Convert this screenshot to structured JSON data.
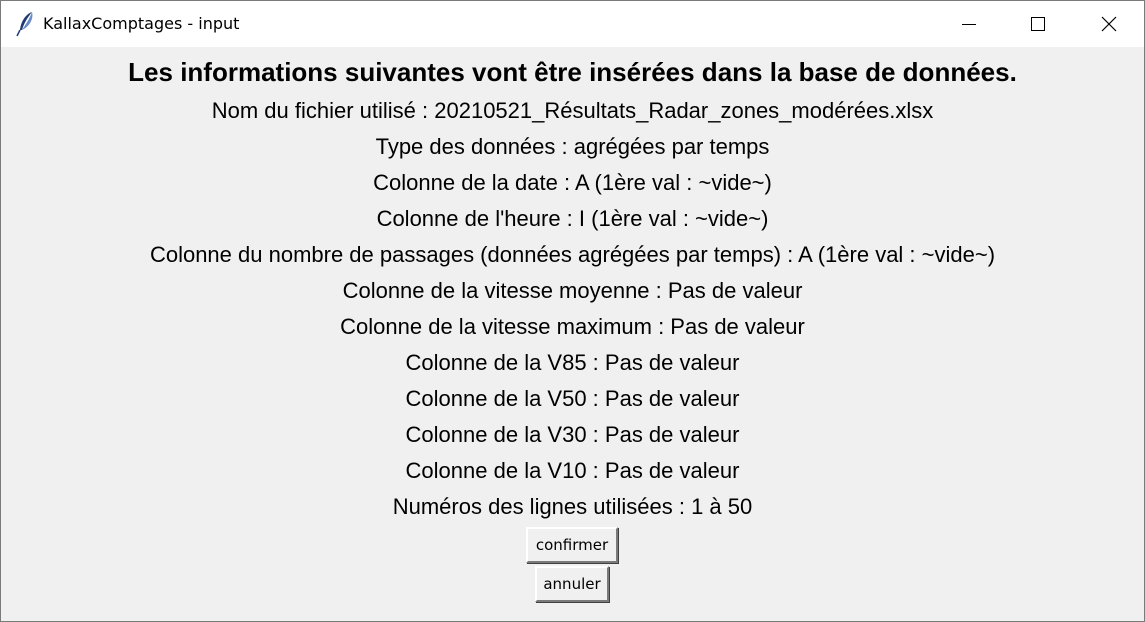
{
  "window": {
    "title": "KallaxComptages - input"
  },
  "dialog": {
    "heading": "Les informations suivantes vont être insérées dans la base de données.",
    "lines": [
      "Nom du fichier utilisé : 20210521_Résultats_Radar_zones_modérées.xlsx",
      "Type des données : agrégées par temps",
      "Colonne de la date : A (1ère val : ~vide~)",
      "Colonne de l'heure : I (1ère val : ~vide~)",
      "Colonne du nombre de passages (données agrégées par temps) : A (1ère val : ~vide~)",
      "Colonne de la vitesse moyenne : Pas de valeur",
      "Colonne de la vitesse maximum : Pas de valeur",
      "Colonne de la V85 : Pas de valeur",
      "Colonne de la V50 : Pas de valeur",
      "Colonne de la V30 : Pas de valeur",
      "Colonne de la V10 : Pas de valeur",
      "Numéros des lignes utilisées : 1 à 50"
    ],
    "confirm_label": "confirmer",
    "cancel_label": "annuler"
  }
}
